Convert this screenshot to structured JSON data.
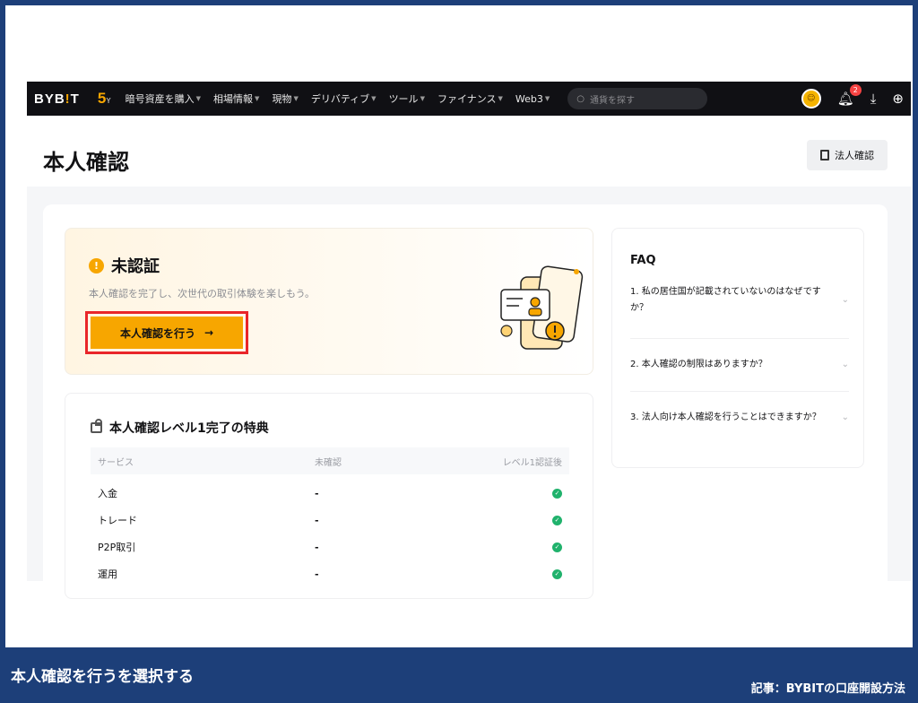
{
  "navbar": {
    "logo_a": "BYB",
    "logo_i": "!",
    "logo_b": "T",
    "anniversary": "5",
    "anniversary_sub": "Y",
    "items": [
      {
        "label": "暗号資産を購入"
      },
      {
        "label": "相場情報"
      },
      {
        "label": "現物"
      },
      {
        "label": "デリバティブ"
      },
      {
        "label": "ツール"
      },
      {
        "label": "ファイナンス"
      },
      {
        "label": "Web3"
      }
    ],
    "search_placeholder": "通貨を探す",
    "notification_count": "2",
    "colors": {
      "bg": "#101014",
      "accent": "#f7a600"
    }
  },
  "header": {
    "title": "本人確認",
    "corporate_button": "法人確認"
  },
  "status": {
    "title": "未認証",
    "subtitle": "本人確認を完了し、次世代の取引体験を楽しもう。",
    "button_label": "本人確認を行う",
    "button_arrow": "→",
    "warn_symbol": "!"
  },
  "benefits": {
    "title": "本人確認レベル1完了の特典",
    "columns": [
      "サービス",
      "未確認",
      "レベル1認証後"
    ],
    "rows": [
      {
        "service": "入金",
        "unverified": "-",
        "level1": "✓"
      },
      {
        "service": "トレード",
        "unverified": "-",
        "level1": "✓"
      },
      {
        "service": "P2P取引",
        "unverified": "-",
        "level1": "✓"
      },
      {
        "service": "運用",
        "unverified": "-",
        "level1": "✓"
      }
    ]
  },
  "faq": {
    "title": "FAQ",
    "items": [
      {
        "q": "1. 私の居住国が記載されていないのはなぜですか？"
      },
      {
        "q": "2. 本人確認の制限はありますか？"
      },
      {
        "q": "3. 法人向け本人確認を行うことはできますか？"
      }
    ],
    "chevron": "⌄"
  },
  "caption": {
    "text": "本人確認を行うを選択する",
    "credit": "記事：BYBITの口座開設方法"
  }
}
